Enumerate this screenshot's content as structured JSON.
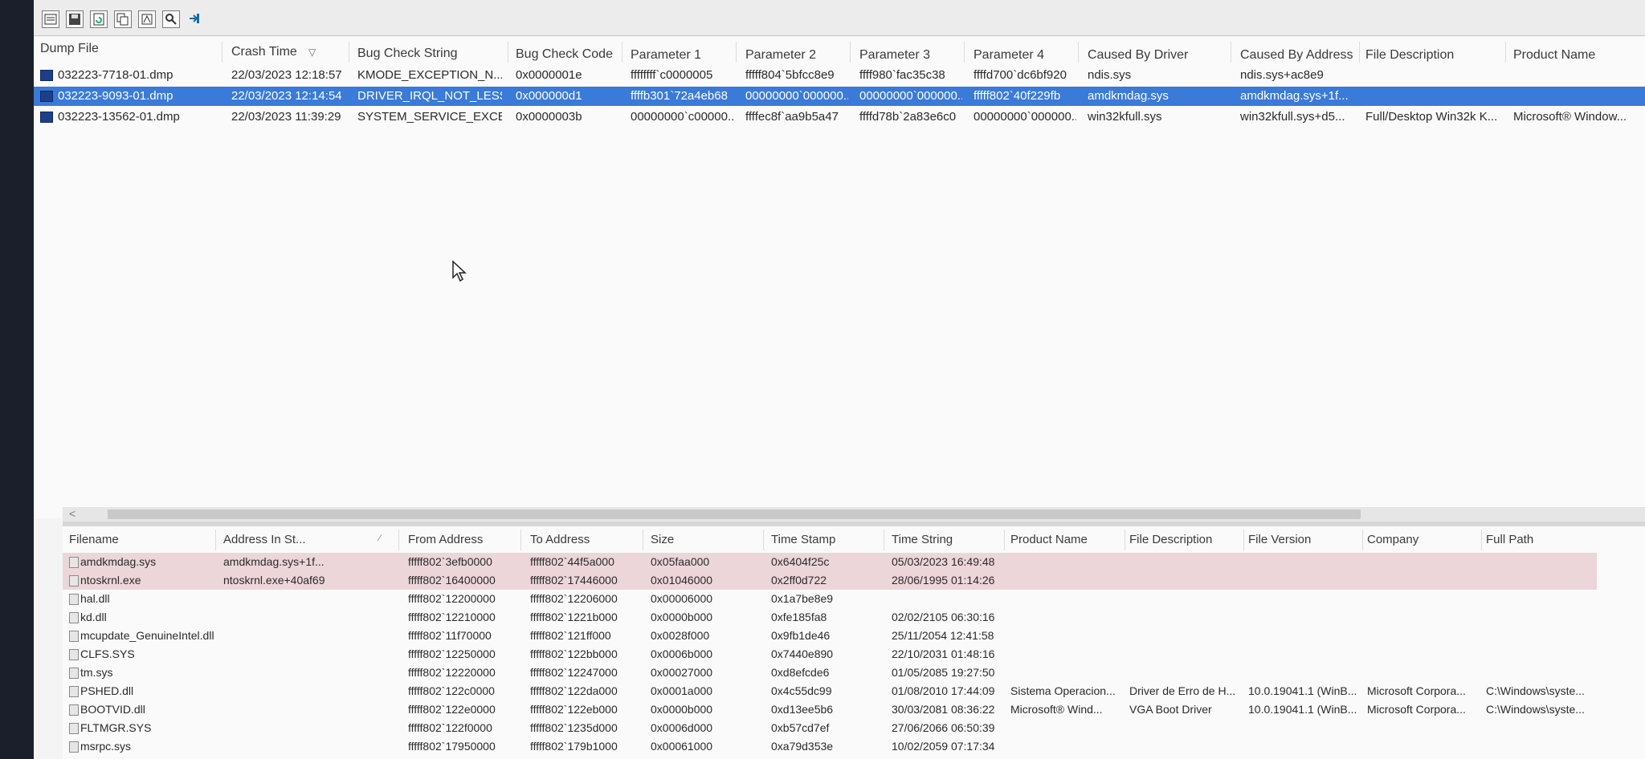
{
  "toolbar": {
    "buttons": [
      "properties-icon",
      "save-icon",
      "refresh-icon",
      "copy-icon",
      "report-icon",
      "find-icon",
      "exit-icon"
    ]
  },
  "upper": {
    "columns": [
      "Dump File",
      "Crash Time",
      "Bug Check String",
      "Bug Check Code",
      "Parameter 1",
      "Parameter 2",
      "Parameter 3",
      "Parameter 4",
      "Caused By Driver",
      "Caused By Address",
      "File Description",
      "Product Name"
    ],
    "rows": [
      [
        "032223-7718-01.dmp",
        "22/03/2023 12:18:57",
        "KMODE_EXCEPTION_N...",
        "0x0000001e",
        "ffffffff`c0000005",
        "fffff804`5bfcc8e9",
        "ffff980`fac35c38",
        "ffffd700`dc6bf920",
        "ndis.sys",
        "ndis.sys+ac8e9",
        "",
        ""
      ],
      [
        "032223-9093-01.dmp",
        "22/03/2023 12:14:54",
        "DRIVER_IRQL_NOT_LESS...",
        "0x000000d1",
        "ffffb301`72a4eb68",
        "00000000`000000...",
        "00000000`000000...",
        "fffff802`40f229fb",
        "amdkmdag.sys",
        "amdkmdag.sys+1f...",
        "",
        ""
      ],
      [
        "032223-13562-01.dmp",
        "22/03/2023 11:39:29",
        "SYSTEM_SERVICE_EXCEP...",
        "0x0000003b",
        "00000000`c00000...",
        "ffffec8f`aa9b5a47",
        "ffffd78b`2a83e6c0",
        "00000000`000000...",
        "win32kfull.sys",
        "win32kfull.sys+d5...",
        "Full/Desktop Win32k K...",
        "Microsoft® Window..."
      ]
    ],
    "selected_index": 1
  },
  "lower": {
    "columns": [
      "Filename",
      "Address In St...",
      "From Address",
      "To Address",
      "Size",
      "Time Stamp",
      "Time String",
      "Product Name",
      "File Description",
      "File Version",
      "Company",
      "Full Path"
    ],
    "rows": [
      [
        "amdkmdag.sys",
        "amdkmdag.sys+1f...",
        "fffff802`3efb0000",
        "fffff802`44f5a000",
        "0x05faa000",
        "0x6404f25c",
        "05/03/2023 16:49:48",
        "",
        "",
        "",
        "",
        ""
      ],
      [
        "ntoskrnl.exe",
        "ntoskrnl.exe+40af69",
        "fffff802`16400000",
        "fffff802`17446000",
        "0x01046000",
        "0x2ff0d722",
        "28/06/1995 01:14:26",
        "",
        "",
        "",
        "",
        ""
      ],
      [
        "hal.dll",
        "",
        "fffff802`12200000",
        "fffff802`12206000",
        "0x00006000",
        "0x1a7be8e9",
        "",
        "",
        "",
        "",
        "",
        ""
      ],
      [
        "kd.dll",
        "",
        "fffff802`12210000",
        "fffff802`1221b000",
        "0x0000b000",
        "0xfe185fa8",
        "02/02/2105 06:30:16",
        "",
        "",
        "",
        "",
        ""
      ],
      [
        "mcupdate_GenuineIntel.dll",
        "",
        "fffff802`11f70000",
        "fffff802`121ff000",
        "0x0028f000",
        "0x9fb1de46",
        "25/11/2054 12:41:58",
        "",
        "",
        "",
        "",
        ""
      ],
      [
        "CLFS.SYS",
        "",
        "fffff802`12250000",
        "fffff802`122bb000",
        "0x0006b000",
        "0x7440e890",
        "22/10/2031 01:48:16",
        "",
        "",
        "",
        "",
        ""
      ],
      [
        "tm.sys",
        "",
        "fffff802`12220000",
        "fffff802`12247000",
        "0x00027000",
        "0xd8efcde6",
        "01/05/2085 19:27:50",
        "",
        "",
        "",
        "",
        ""
      ],
      [
        "PSHED.dll",
        "",
        "fffff802`122c0000",
        "fffff802`122da000",
        "0x0001a000",
        "0x4c55dc99",
        "01/08/2010 17:44:09",
        "Sistema Operacion...",
        "Driver de Erro de H...",
        "10.0.19041.1 (WinB...",
        "Microsoft Corpora...",
        "C:\\Windows\\syste..."
      ],
      [
        "BOOTVID.dll",
        "",
        "fffff802`122e0000",
        "fffff802`122eb000",
        "0x0000b000",
        "0xd13ee5b6",
        "30/03/2081 08:36:22",
        "Microsoft® Wind...",
        "VGA Boot Driver",
        "10.0.19041.1 (WinB...",
        "Microsoft Corpora...",
        "C:\\Windows\\syste..."
      ],
      [
        "FLTMGR.SYS",
        "",
        "fffff802`122f0000",
        "fffff802`1235d000",
        "0x0006d000",
        "0xb57cd7ef",
        "27/06/2066 06:50:39",
        "",
        "",
        "",
        "",
        ""
      ],
      [
        "msrpc.sys",
        "",
        "fffff802`17950000",
        "fffff802`179b1000",
        "0x00061000",
        "0xa79d353e",
        "10/02/2059 07:17:34",
        "",
        "",
        "",
        "",
        ""
      ]
    ],
    "highlighted": [
      0,
      1
    ]
  },
  "colors": {
    "selection": "#3a7ad8",
    "highlight": "#ecd6da",
    "driver_icon": "#1d3f8a"
  }
}
